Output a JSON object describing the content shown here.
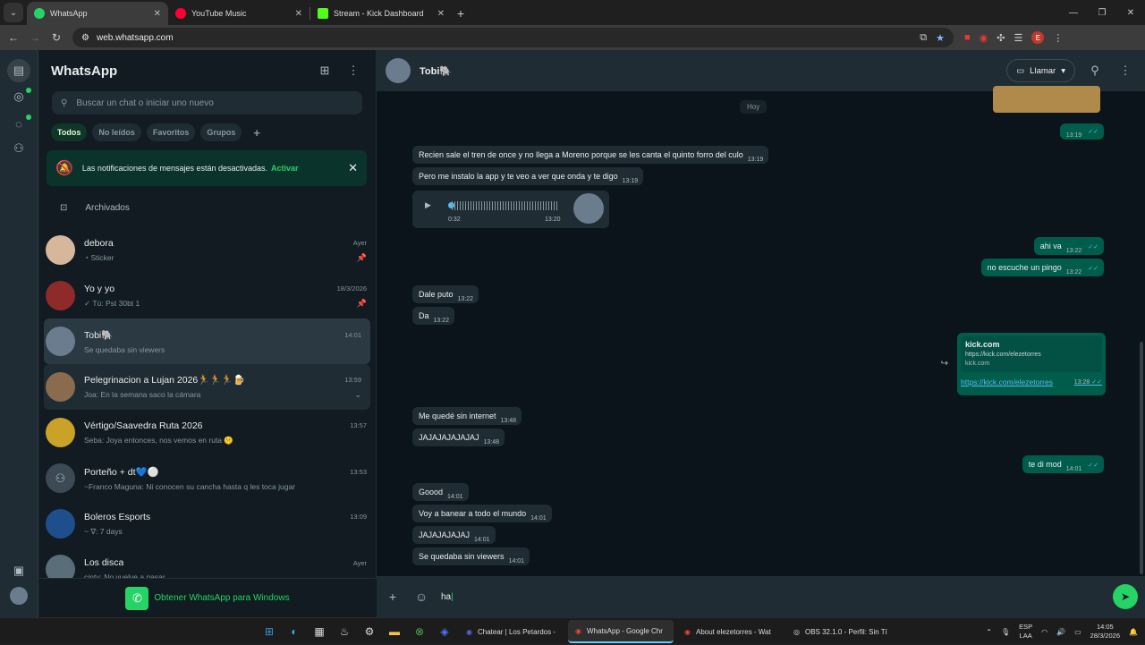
{
  "browser": {
    "tabs": [
      {
        "title": "WhatsApp",
        "active": true,
        "color": "#25d366"
      },
      {
        "title": "YouTube Music",
        "active": false,
        "color": "#ff0033"
      },
      {
        "title": "Stream - Kick Dashboard",
        "active": false,
        "color": "#53fc18"
      }
    ],
    "url": "web.whatsapp.com"
  },
  "sidebar": {
    "title": "WhatsApp",
    "search_placeholder": "Buscar un chat o iniciar uno nuevo",
    "filters": [
      "Todos",
      "No leídos",
      "Favoritos",
      "Grupos"
    ],
    "notice_text": "Las notificaciones de mensajes están desactivadas.",
    "notice_action": "Activar",
    "archived_label": "Archivados",
    "chats": [
      {
        "name": "debora",
        "time": "Ayer",
        "preview": "Sticker",
        "pinned": true,
        "avatar": "#d7b79b"
      },
      {
        "name": "Yo y yo",
        "time": "18/3/2026",
        "preview": "✓ Tú: Pst 30bt 1",
        "pinned": true,
        "avatar": "#8e2a2a"
      },
      {
        "name": "Tobi🐘",
        "time": "14:01",
        "preview": "Se quedaba sin viewers",
        "pinned": false,
        "avatar": "#6b7c8f"
      },
      {
        "name": "Pelegrinacion a Lujan 2026🏃🏃🏃🍺",
        "time": "13:59",
        "preview": "Joa: En la semana saco la cámara",
        "pinned": false,
        "avatar": "#8a6b4e"
      },
      {
        "name": "Vértigo/Saavedra Ruta 2026",
        "time": "13:57",
        "preview": "Seba: Joya entonces, nos vemos en ruta 🤫",
        "pinned": false,
        "avatar": "#c9a227"
      },
      {
        "name": "Porteño + dt💙⚪",
        "time": "13:53",
        "preview": "~Franco Maguna: Ni conocen su cancha hasta q les toca jugar",
        "pinned": false,
        "avatar": "#3b4a54"
      },
      {
        "name": "Boleros Esports",
        "time": "13:09",
        "preview": "~ ∇: 7 days",
        "pinned": false,
        "avatar": "#1f4e8c"
      },
      {
        "name": "Los disca",
        "time": "Ayer",
        "preview": "cinty: No vuelve a pasar",
        "pinned": false,
        "avatar": "#5a6e7a"
      }
    ],
    "get_app": "Obtener WhatsApp para Windows"
  },
  "conversation": {
    "contact": "Tobi🐘",
    "call_label": "Llamar",
    "day_separator": "Hoy",
    "composer_text": "ha",
    "messages": [
      {
        "dir": "out",
        "text": "",
        "time": "13:19"
      },
      {
        "dir": "in",
        "text": "Recien sale el tren de once y no llega a Moreno porque se les canta el quinto forro del culo",
        "time": "13:19"
      },
      {
        "dir": "in",
        "text": "Pero me instalo la app y te veo a ver que onda y te digo",
        "time": "13:19"
      },
      {
        "dir": "in",
        "type": "voice",
        "duration": "0:32",
        "time": "13:20"
      },
      {
        "dir": "out",
        "text": "ahi va",
        "time": "13:22"
      },
      {
        "dir": "out",
        "text": "no escuche un pingo",
        "time": "13:22"
      },
      {
        "dir": "in",
        "text": "Dale puto",
        "time": "13:22"
      },
      {
        "dir": "in",
        "text": "Da",
        "time": "13:22"
      },
      {
        "dir": "out",
        "type": "link",
        "title": "kick.com",
        "url_line": "https://kick.com/elezetorres",
        "domain": "kick.com",
        "link": "https://kick.com/elezetorres",
        "time": "13:28"
      },
      {
        "dir": "in",
        "text": "Me quedé sin internet",
        "time": "13:48"
      },
      {
        "dir": "in",
        "text": "JAJAJAJAJAJAJ",
        "time": "13:48"
      },
      {
        "dir": "out",
        "text": "te di mod",
        "time": "14:01"
      },
      {
        "dir": "in",
        "text": "Goood",
        "time": "14:01"
      },
      {
        "dir": "in",
        "text": "Voy a banear a todo el mundo",
        "time": "14:01"
      },
      {
        "dir": "in",
        "text": "JAJAJAJAJAJ",
        "time": "14:01"
      },
      {
        "dir": "in",
        "text": "Se quedaba sin viewers",
        "time": "14:01"
      }
    ]
  },
  "taskbar": {
    "apps": [
      {
        "label": "Chatear | Los Petardos -",
        "active": false
      },
      {
        "label": "WhatsApp - Google Chr",
        "active": true
      },
      {
        "label": "About elezetorres - Wat",
        "active": false
      },
      {
        "label": "OBS 32.1.0 - Perfil: Sin Tí",
        "active": false
      }
    ],
    "lang_top": "ESP",
    "lang_bottom": "LAA",
    "time": "14:05",
    "date": "28/3/2026"
  }
}
